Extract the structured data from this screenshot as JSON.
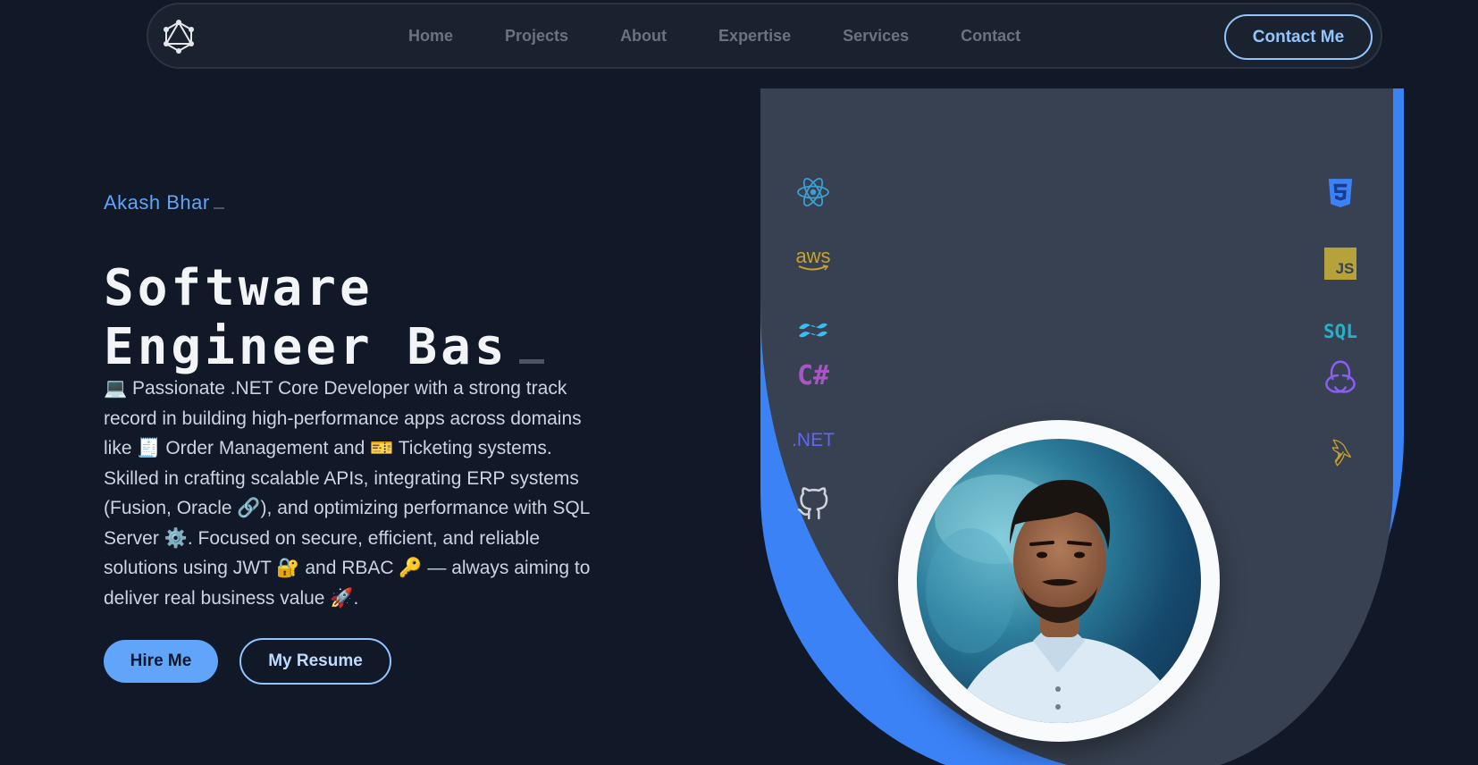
{
  "nav": {
    "links": [
      "Home",
      "Projects",
      "About",
      "Expertise",
      "Services",
      "Contact"
    ],
    "contact_label": "Contact Me"
  },
  "hero": {
    "name": "Akash Bhar",
    "title_line1": "Software",
    "title_line2": "Engineer Bas",
    "description": "💻 Passionate .NET Core Developer with a strong track record in building high-performance apps across domains like 🧾 Order Management and 🎫 Ticketing systems. Skilled in crafting scalable APIs, integrating ERP systems (Fusion, Oracle 🔗), and optimizing performance with SQL Server ⚙️. Focused on secure, efficient, and reliable solutions using JWT 🔐 and RBAC 🔑 — always aiming to deliver real business value 🚀.",
    "hire_label": "Hire Me",
    "resume_label": "My Resume"
  },
  "tech_icons": {
    "left": [
      "react-icon",
      "aws-icon",
      "tailwind-icon",
      "csharp-icon",
      "dotnet-icon",
      "github-icon"
    ],
    "right": [
      "css3-icon",
      "javascript-icon",
      "sql-icon",
      "redux-icon",
      "mysql-icon"
    ],
    "aws_text": "aws",
    "csharp_text": "C#",
    "dotnet_text": ".NET",
    "sql_text": "SQL",
    "js_text": "JS"
  },
  "colors": {
    "background": "#111827",
    "accent": "#60a5fa",
    "panel": "#374151",
    "panel_edge": "#3b82f6"
  }
}
